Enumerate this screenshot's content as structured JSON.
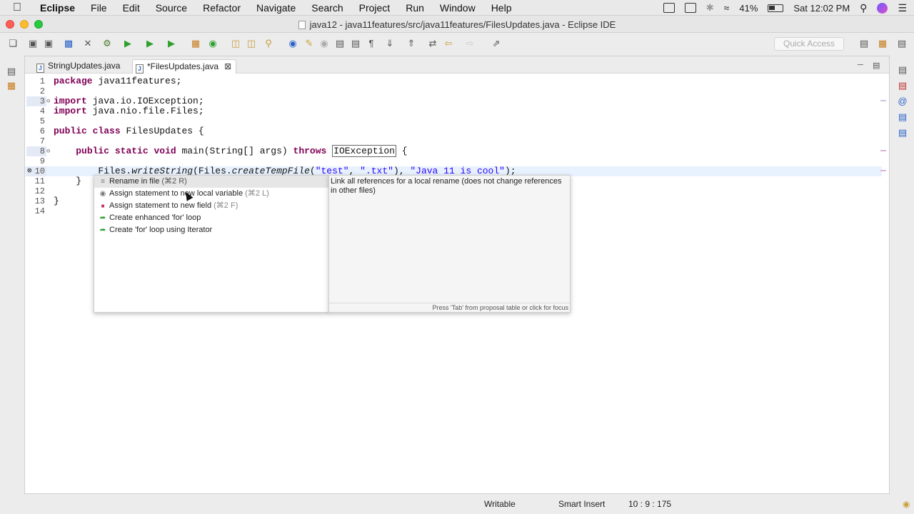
{
  "menubar": {
    "app": "Eclipse",
    "items": [
      "File",
      "Edit",
      "Source",
      "Refactor",
      "Navigate",
      "Search",
      "Project",
      "Run",
      "Window",
      "Help"
    ],
    "battery": "41%",
    "clock": "Sat 12:02 PM"
  },
  "window": {
    "title": "java12 - java11features/src/java11features/FilesUpdates.java - Eclipse IDE"
  },
  "toolbar": {
    "quick_access_placeholder": "Quick Access"
  },
  "editor": {
    "tabs": [
      {
        "label": "StringUpdates.java",
        "active": false
      },
      {
        "label": "*FilesUpdates.java",
        "active": true
      }
    ],
    "lines": [
      {
        "num": "1",
        "text": "package java11features;"
      },
      {
        "num": "2",
        "text": ""
      },
      {
        "num": "3",
        "text": "import java.io.IOException;"
      },
      {
        "num": "4",
        "text": "import java.nio.file.Files;"
      },
      {
        "num": "5",
        "text": ""
      },
      {
        "num": "6",
        "text": "public class FilesUpdates {"
      },
      {
        "num": "7",
        "text": ""
      },
      {
        "num": "8",
        "text": "    public static void main(String[] args) throws IOException {"
      },
      {
        "num": "9",
        "text": ""
      },
      {
        "num": "10",
        "text": "        Files.writeString(Files.createTempFile(\"test\", \".txt\"), \"Java 11 is cool\");"
      },
      {
        "num": "11",
        "text": "    }"
      },
      {
        "num": "12",
        "text": ""
      },
      {
        "num": "13",
        "text": "}"
      },
      {
        "num": "14",
        "text": ""
      }
    ],
    "code": {
      "kw_package": "package",
      "pkg_name": " java11features;",
      "kw_import": "import",
      "imp1": " java.io.IOException;",
      "imp2": " java.nio.file.Files;",
      "kw_public": "public",
      "kw_class": "class",
      "class_decl": " FilesUpdates {",
      "kw_static": "static",
      "kw_void": "void",
      "main_sig": " main(String[] args) ",
      "kw_throws": "throws",
      "exc": "IOException",
      "brace_open": " {",
      "call_files": "Files.",
      "call_write": "writeString",
      "call_mid": "(Files.",
      "call_temp": "createTempFile",
      "paren": "(",
      "s_test": "\"test\"",
      "comma": ", ",
      "s_txt": "\".txt\"",
      "close_comma": "), ",
      "s_cool": "\"Java 11 is cool\"",
      "end": ");",
      "brace_close_inner": "    }",
      "brace_close": "}"
    }
  },
  "quickfix": {
    "proposals": [
      {
        "label": "Rename in file",
        "shortcut": "(⌘2 R)",
        "icon": "rename-icon",
        "selected": true
      },
      {
        "label": "Assign statement to new local variable",
        "shortcut": "(⌘2 L)",
        "icon": "local-variable-icon",
        "selected": false
      },
      {
        "label": "Assign statement to new field",
        "shortcut": "(⌘2 F)",
        "icon": "field-icon",
        "selected": false
      },
      {
        "label": "Create enhanced 'for' loop",
        "shortcut": "",
        "icon": "template-icon",
        "selected": false
      },
      {
        "label": "Create 'for' loop using Iterator",
        "shortcut": "",
        "icon": "template-icon",
        "selected": false
      }
    ],
    "description": "Link all references for a local rename (does not change references in other files)",
    "footer": "Press 'Tab' from proposal table or click for focus"
  },
  "statusbar": {
    "writable": "Writable",
    "insert_mode": "Smart Insert",
    "position": "10 : 9 : 175"
  },
  "colors": {
    "keyword": "#7f0055",
    "string": "#2a00ff",
    "current_line": "#e8f2fe"
  }
}
